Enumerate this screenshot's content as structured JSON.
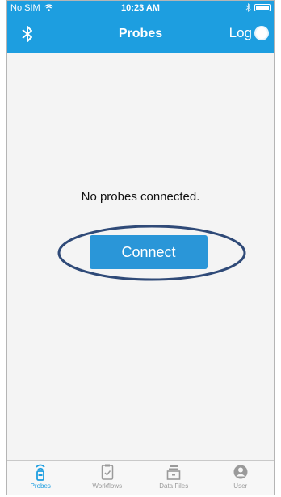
{
  "status_bar": {
    "carrier": "No SIM",
    "wifi_icon": "wifi-icon",
    "time": "10:23 AM",
    "bluetooth_icon": "bluetooth-icon",
    "battery_icon": "battery-icon"
  },
  "nav": {
    "title": "Probes",
    "left_icon": "bluetooth-icon",
    "log_label": "Log"
  },
  "main": {
    "empty_message": "No probes connected.",
    "connect_label": "Connect"
  },
  "tabs": [
    {
      "label": "Probes",
      "icon": "probe-icon",
      "active": true
    },
    {
      "label": "Workflows",
      "icon": "clipboard-icon",
      "active": false
    },
    {
      "label": "Data Files",
      "icon": "drawer-icon",
      "active": false
    },
    {
      "label": "User",
      "icon": "user-icon",
      "active": false
    }
  ],
  "colors": {
    "brand_blue": "#1d9ee0",
    "button_blue": "#2a96d8",
    "highlight_oval": "#2f4a78",
    "inactive_tab": "#9a9a9a"
  }
}
